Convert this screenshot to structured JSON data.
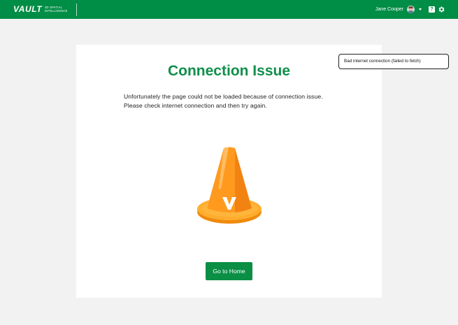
{
  "header": {
    "logo_text": "VAULT",
    "logo_tagline_line1": "3D SPATIAL",
    "logo_tagline_line2": "INTELLIGENCE",
    "user_name": "Jane Cooper",
    "help_label": "?",
    "icons": [
      "avatar",
      "chevron-down-icon",
      "help-icon",
      "gear-icon"
    ],
    "brand_color": "#008d45"
  },
  "error": {
    "title": "Connection Issue",
    "message_line1": "Unfortunately the page could not be loaded because of connection issue.",
    "message_line2": "Please check internet connection and then try again.",
    "illustration": "traffic-cone-icon",
    "cone_logo_letter": "V",
    "home_button_label": "Go to Home",
    "accent_color": "#0f8f4a",
    "cone_color": "#ff9a1f"
  },
  "toast": {
    "text": "Bad internet connection (failed to fetch)"
  }
}
